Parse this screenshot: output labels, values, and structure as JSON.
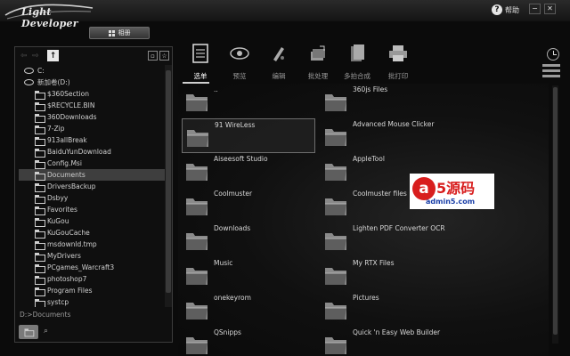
{
  "app": {
    "title": "Light Developer"
  },
  "titlebar": {
    "help_label": "帮助",
    "help_symbol": "?",
    "minimize_symbol": "−",
    "close_symbol": "✕"
  },
  "album_button": {
    "label": "相册"
  },
  "left_nav": {
    "back_symbol": "⇦",
    "forward_symbol": "⇨",
    "up_symbol": "↑",
    "tree": [
      {
        "label": "C:",
        "type": "drive"
      },
      {
        "label": "新加卷(D:)",
        "type": "drive"
      },
      {
        "label": "$360Section",
        "type": "folder"
      },
      {
        "label": "$RECYCLE.BIN",
        "type": "folder"
      },
      {
        "label": "360Downloads",
        "type": "folder"
      },
      {
        "label": "7-Zip",
        "type": "folder"
      },
      {
        "label": "913allBreak",
        "type": "folder"
      },
      {
        "label": "BaiduYunDownload",
        "type": "folder"
      },
      {
        "label": "Config.Msi",
        "type": "folder"
      },
      {
        "label": "Documents",
        "type": "folder",
        "selected": true
      },
      {
        "label": "DriversBackup",
        "type": "folder"
      },
      {
        "label": "Dsbyy",
        "type": "folder"
      },
      {
        "label": "Favorites",
        "type": "folder"
      },
      {
        "label": "KuGou",
        "type": "folder"
      },
      {
        "label": "KuGouCache",
        "type": "folder"
      },
      {
        "label": "msdownld.tmp",
        "type": "folder"
      },
      {
        "label": "MyDrivers",
        "type": "folder"
      },
      {
        "label": "PCgames_Warcraft3",
        "type": "folder"
      },
      {
        "label": "photoshop7",
        "type": "folder"
      },
      {
        "label": "Program Files",
        "type": "folder"
      },
      {
        "label": "systcp",
        "type": "folder"
      }
    ],
    "current_path": "D:>Documents"
  },
  "toolbar": {
    "items": [
      {
        "label": "选单",
        "icon": "menu-list-icon",
        "active": true
      },
      {
        "label": "预览",
        "icon": "eye-icon"
      },
      {
        "label": "编辑",
        "icon": "edit-brush-icon"
      },
      {
        "label": "批处理",
        "icon": "batch-icon"
      },
      {
        "label": "多拍合成",
        "icon": "merge-pages-icon"
      },
      {
        "label": "批打印",
        "icon": "printer-icon"
      }
    ]
  },
  "files": {
    "col1": [
      "..",
      "91 WireLess",
      "Aiseesoft Studio",
      "Coolmuster",
      "Downloads",
      "Music",
      "onekeyrom",
      "QSnipps"
    ],
    "col2": [
      "360js Files",
      "Advanced Mouse Clicker",
      "AppleTool",
      "Coolmuster files",
      "Lighten PDF Converter OCR",
      "My RTX Files",
      "Pictures",
      "Quick 'n Easy Web Builder"
    ],
    "selected": "91 WireLess"
  },
  "watermark": {
    "letter": "a",
    "big_text": "5源码",
    "small_text": "admin5.com"
  }
}
